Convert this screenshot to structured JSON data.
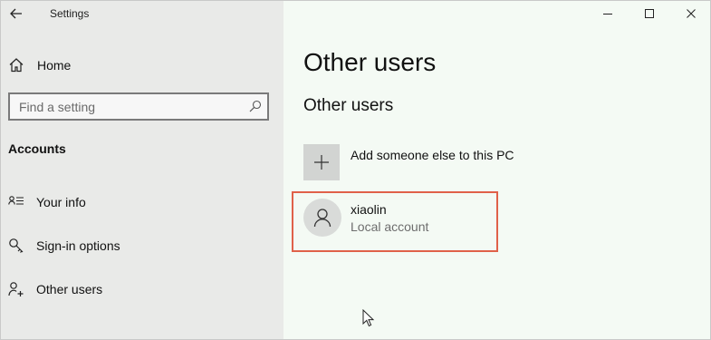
{
  "window": {
    "title": "Settings"
  },
  "sidebar": {
    "home_label": "Home",
    "search": {
      "placeholder": "Find a setting",
      "value": ""
    },
    "section_heading": "Accounts",
    "items": [
      {
        "label": "Your info",
        "icon": "your-info-icon"
      },
      {
        "label": "Sign-in options",
        "icon": "key-icon"
      },
      {
        "label": "Other users",
        "icon": "add-person-icon"
      }
    ]
  },
  "main": {
    "page_title": "Other users",
    "section_title": "Other users",
    "add_label": "Add someone else to this PC",
    "users": [
      {
        "name": "xiaolin",
        "type": "Local account"
      }
    ]
  },
  "colors": {
    "sidebar_bg": "#e9eae8",
    "main_bg": "#f4faf4",
    "highlight": "#e0614a"
  }
}
